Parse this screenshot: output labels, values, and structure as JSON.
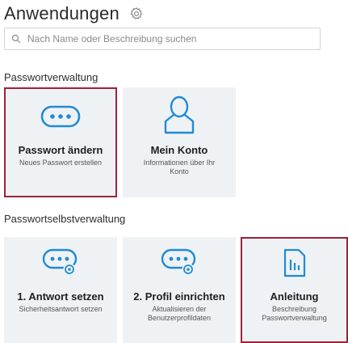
{
  "header": {
    "title": "Anwendungen",
    "settings_icon": "gear-icon"
  },
  "search": {
    "placeholder": "Nach Name oder Beschreibung suchen",
    "icon": "search-icon"
  },
  "sections": [
    {
      "title": "Passwortverwaltung",
      "tiles": [
        {
          "name": "Passwort ändern",
          "description": "Neues Passwort erstellen",
          "icon": "password-dots-icon",
          "selected": true
        },
        {
          "name": "Mein Konto",
          "description": "Informationen über Ihr Konto",
          "icon": "user-icon",
          "selected": false
        }
      ]
    },
    {
      "title": "Passwortselbstverwaltung",
      "tiles": [
        {
          "name": "1. Antwort setzen",
          "description": "Sicherheitsantwort setzen",
          "icon": "password-settings-icon",
          "selected": false
        },
        {
          "name": "2. Profil einrichten",
          "description": "Aktualisieren der Benutzerprofildaten",
          "icon": "password-settings-icon",
          "selected": false
        },
        {
          "name": "Anleitung",
          "description": "Beschreibung Passwortverwaltung",
          "icon": "document-chart-icon",
          "selected": true
        }
      ]
    }
  ],
  "colors": {
    "accent": "#1f8bd6",
    "selected_border": "#a0213a",
    "tile_bg": "#eff2f4"
  }
}
